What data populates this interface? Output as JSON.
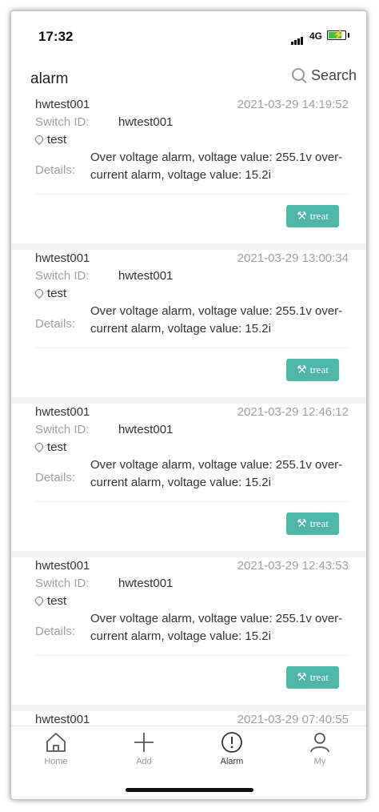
{
  "status_bar": {
    "time": "17:32",
    "network": "4G"
  },
  "header": {
    "title": "alarm",
    "search_label": "Search"
  },
  "alarms": [
    {
      "device": "hwtest001",
      "datetime": "2021-03-29 14:19:52",
      "switch_label": "Switch ID:",
      "switch_id": "hwtest001",
      "location": "test",
      "details_label": "Details:",
      "details": "Over voltage alarm, voltage value: 255.1v over-current alarm, voltage value: 15.2i",
      "treat_label": "treat"
    },
    {
      "device": "hwtest001",
      "datetime": "2021-03-29 13:00:34",
      "switch_label": "Switch ID:",
      "switch_id": "hwtest001",
      "location": "test",
      "details_label": "Details:",
      "details": "Over voltage alarm, voltage value: 255.1v over-current alarm, voltage value: 15.2i",
      "treat_label": "treat"
    },
    {
      "device": "hwtest001",
      "datetime": "2021-03-29 12:46:12",
      "switch_label": "Switch ID:",
      "switch_id": "hwtest001",
      "location": "test",
      "details_label": "Details:",
      "details": "Over voltage alarm, voltage value: 255.1v over-current alarm, voltage value: 15.2i",
      "treat_label": "treat"
    },
    {
      "device": "hwtest001",
      "datetime": "2021-03-29 12:43:53",
      "switch_label": "Switch ID:",
      "switch_id": "hwtest001",
      "location": "test",
      "details_label": "Details:",
      "details": "Over voltage alarm, voltage value: 255.1v over-current alarm, voltage value: 15.2i",
      "treat_label": "treat"
    },
    {
      "device": "hwtest001",
      "datetime": "2021-03-29 07:40:55"
    }
  ],
  "tabbar": {
    "items": [
      {
        "label": "Home",
        "icon": "home-icon"
      },
      {
        "label": "Add",
        "icon": "plus-icon"
      },
      {
        "label": "Alarm",
        "icon": "alert-circle-icon",
        "active": true
      },
      {
        "label": "My",
        "icon": "user-icon"
      }
    ]
  },
  "colors": {
    "accent": "#4cb8aa",
    "muted_text": "#a0a0a0"
  }
}
